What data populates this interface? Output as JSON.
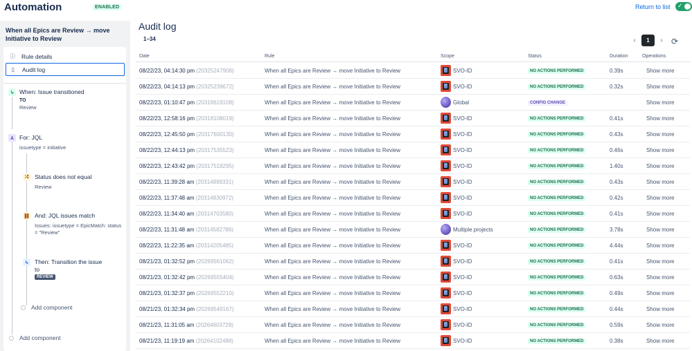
{
  "app": {
    "title": "Automation",
    "status_badge": "ENABLED",
    "return_link": "Return to list"
  },
  "sidebar": {
    "rule_title": "When all Epics are Review → move Initiative to Review",
    "nav": [
      {
        "label": "Rule details",
        "icon": "info-icon"
      },
      {
        "label": "Audit log",
        "icon": "document-icon",
        "active": true
      }
    ],
    "trigger": {
      "title": "When: Issue transitioned",
      "to_label": "TO",
      "to_value": "Review"
    },
    "branch": {
      "title": "For: JQL",
      "query": "issuetype = initiative"
    },
    "condition1": {
      "title": "Status does not equal",
      "value": "Review"
    },
    "condition2": {
      "title": "And: JQL issues match",
      "value_line1": "Issues: issuetype = EpicMatch: status",
      "value_line2": "= \"Review\""
    },
    "action": {
      "title_line1": "Then: Transition the issue",
      "title_line2": "to",
      "lozenge": "REVIEW"
    },
    "add_component_inner": "Add component",
    "add_component_outer": "Add component"
  },
  "main": {
    "title": "Audit log",
    "range": "1–34",
    "current_page": "1",
    "columns": {
      "date": "Date",
      "rule": "Rule",
      "scope": "Scope",
      "status": "Status",
      "duration": "Duration",
      "operations": "Operations"
    },
    "rows": [
      {
        "date": "08/22/23, 04:14:30 pm",
        "id": "(20325247906)",
        "rule": "When all Epics are Review → move Initiative to Review",
        "scope": "SVO-ID",
        "scope_type": "project",
        "status": "NO ACTIONS PERFORMED",
        "status_type": "none",
        "duration": "0.39s",
        "op": "Show more"
      },
      {
        "date": "08/22/23, 04:14:13 pm",
        "id": "(20325239672)",
        "rule": "When all Epics are Review → move Initiative to Review",
        "scope": "SVO-ID",
        "scope_type": "project",
        "status": "NO ACTIONS PERFORMED",
        "status_type": "none",
        "duration": "0.32s",
        "op": "Show more"
      },
      {
        "date": "08/22/23, 01:10:47 pm",
        "id": "(20318619108)",
        "rule": "When all Epics are Review → move Initiative to Review",
        "scope": "Global",
        "scope_type": "globe",
        "status": "CONFIG CHANGE",
        "status_type": "config",
        "duration": "",
        "op": "Show more"
      },
      {
        "date": "08/22/23, 12:58:16 pm",
        "id": "(20318108019)",
        "rule": "When all Epics are Review → move Initiative to Review",
        "scope": "SVO-ID",
        "scope_type": "project",
        "status": "NO ACTIONS PERFORMED",
        "status_type": "none",
        "duration": "0.41s",
        "op": "Show more"
      },
      {
        "date": "08/22/23, 12:45:50 pm",
        "id": "(20317600130)",
        "rule": "When all Epics are Review → move Initiative to Review",
        "scope": "SVO-ID",
        "scope_type": "project",
        "status": "NO ACTIONS PERFORMED",
        "status_type": "none",
        "duration": "0.43s",
        "op": "Show more"
      },
      {
        "date": "08/22/23, 12:44:13 pm",
        "id": "(20317535523)",
        "rule": "When all Epics are Review → move Initiative to Review",
        "scope": "SVO-ID",
        "scope_type": "project",
        "status": "NO ACTIONS PERFORMED",
        "status_type": "none",
        "duration": "0.46s",
        "op": "Show more"
      },
      {
        "date": "08/22/23, 12:43:42 pm",
        "id": "(20317518295)",
        "rule": "When all Epics are Review → move Initiative to Review",
        "scope": "SVO-ID",
        "scope_type": "project",
        "status": "NO ACTIONS PERFORMED",
        "status_type": "none",
        "duration": "1.40s",
        "op": "Show more"
      },
      {
        "date": "08/22/23, 11:39:28 am",
        "id": "(20314899331)",
        "rule": "When all Epics are Review → move Initiative to Review",
        "scope": "SVO-ID",
        "scope_type": "project",
        "status": "NO ACTIONS PERFORMED",
        "status_type": "none",
        "duration": "0.43s",
        "op": "Show more"
      },
      {
        "date": "08/22/23, 11:37:48 am",
        "id": "(20314830972)",
        "rule": "When all Epics are Review → move Initiative to Review",
        "scope": "SVO-ID",
        "scope_type": "project",
        "status": "NO ACTIONS PERFORMED",
        "status_type": "none",
        "duration": "0.42s",
        "op": "Show more"
      },
      {
        "date": "08/22/23, 11:34:40 am",
        "id": "(20314703580)",
        "rule": "When all Epics are Review → move Initiative to Review",
        "scope": "SVO-ID",
        "scope_type": "project",
        "status": "NO ACTIONS PERFORMED",
        "status_type": "none",
        "duration": "0.41s",
        "op": "Show more"
      },
      {
        "date": "08/22/23, 11:31:48 am",
        "id": "(20314582786)",
        "rule": "When all Epics are Review → move Initiative to Review",
        "scope": "Multiple projects",
        "scope_type": "globe",
        "status": "NO ACTIONS PERFORMED",
        "status_type": "none",
        "duration": "3.78s",
        "op": "Show more"
      },
      {
        "date": "08/22/23, 11:22:35 am",
        "id": "(20314205485)",
        "rule": "When all Epics are Review → move Initiative to Review",
        "scope": "SVO-ID",
        "scope_type": "project",
        "status": "NO ACTIONS PERFORMED",
        "status_type": "none",
        "duration": "4.44s",
        "op": "Show more"
      },
      {
        "date": "08/21/23, 01:32:52 pm",
        "id": "(20269561062)",
        "rule": "When all Epics are Review → move Initiative to Review",
        "scope": "SVO-ID",
        "scope_type": "project",
        "status": "NO ACTIONS PERFORMED",
        "status_type": "none",
        "duration": "0.41s",
        "op": "Show more"
      },
      {
        "date": "08/21/23, 01:32:42 pm",
        "id": "(20269555404)",
        "rule": "When all Epics are Review → move Initiative to Review",
        "scope": "SVO-ID",
        "scope_type": "project",
        "status": "NO ACTIONS PERFORMED",
        "status_type": "none",
        "duration": "0.63s",
        "op": "Show more"
      },
      {
        "date": "08/21/23, 01:32:37 pm",
        "id": "(20269552210)",
        "rule": "When all Epics are Review → move Initiative to Review",
        "scope": "SVO-ID",
        "scope_type": "project",
        "status": "NO ACTIONS PERFORMED",
        "status_type": "none",
        "duration": "0.49s",
        "op": "Show more"
      },
      {
        "date": "08/21/23, 01:32:34 pm",
        "id": "(20269549167)",
        "rule": "When all Epics are Review → move Initiative to Review",
        "scope": "SVO-ID",
        "scope_type": "project",
        "status": "NO ACTIONS PERFORMED",
        "status_type": "none",
        "duration": "0.44s",
        "op": "Show more"
      },
      {
        "date": "08/21/23, 11:31:05 am",
        "id": "(20264603728)",
        "rule": "When all Epics are Review → move Initiative to Review",
        "scope": "SVO-ID",
        "scope_type": "project",
        "status": "NO ACTIONS PERFORMED",
        "status_type": "none",
        "duration": "0.59s",
        "op": "Show more"
      },
      {
        "date": "08/21/23, 11:19:19 am",
        "id": "(20264102488)",
        "rule": "When all Epics are Review → move Initiative to Review",
        "scope": "SVO-ID",
        "scope_type": "project",
        "status": "NO ACTIONS PERFORMED",
        "status_type": "none",
        "duration": "0.38s",
        "op": "Show more"
      }
    ]
  }
}
